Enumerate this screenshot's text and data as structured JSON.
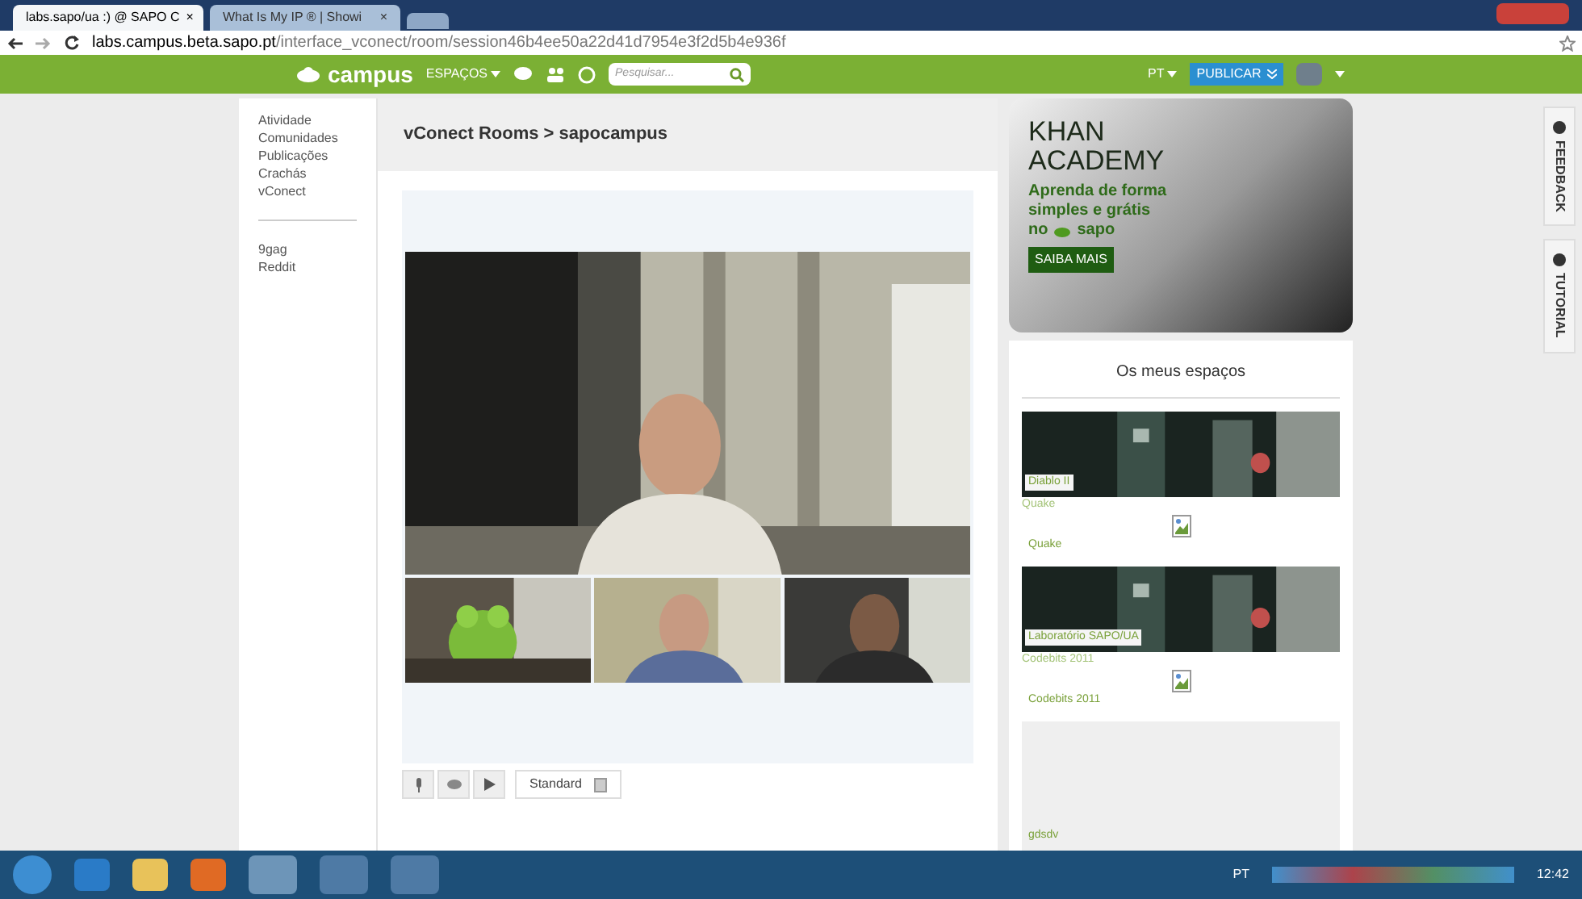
{
  "browser": {
    "tabs": [
      {
        "label": "labs.sapo/ua :) @ SAPO C",
        "selected": true,
        "close": "×"
      },
      {
        "label": "What Is My IP ® | Showi",
        "selected": false,
        "close": "×"
      }
    ],
    "url_host": "labs.campus.beta.sapo.pt",
    "url_path": "/interface_vconect/room/session46b4ee50a22d41d7954e3f2d5b4e936f"
  },
  "navbar": {
    "logo": "campus",
    "menu": "ESPAÇOS",
    "search": {
      "placeholder": "Pesquisar..."
    },
    "language": "PT",
    "publish": "PUBLICAR"
  },
  "sidebar": {
    "items": [
      {
        "label": "Atividade"
      },
      {
        "label": "Comunidades"
      },
      {
        "label": "Publicações"
      },
      {
        "label": "Crachás"
      },
      {
        "label": "vConect"
      }
    ],
    "links": [
      {
        "label": "9gag"
      },
      {
        "label": "Reddit"
      }
    ]
  },
  "room": {
    "title": "vConect Rooms > sapocampus",
    "quality": "Standard"
  },
  "ad": {
    "title_1": "KHAN",
    "title_2": "ACADEMY",
    "line_1": "Aprenda de forma",
    "line_2": "simples e grátis",
    "line_3_prefix": "no",
    "line_3_brand": "sapo",
    "button": "SAIBA MAIS"
  },
  "spaces": {
    "title": "Os meus espaços",
    "items": [
      {
        "banner_label": "Diablo II",
        "name": "Quake",
        "caption": "Quake"
      },
      {
        "banner_label": "Laboratório SAPO/UA",
        "name": "Codebits 2011",
        "caption": "Codebits 2011"
      }
    ],
    "last": "gdsdv"
  },
  "side_tabs": [
    {
      "label": "FEEDBACK"
    },
    {
      "label": "TUTORIAL"
    }
  ],
  "taskbar": {
    "language": "PT",
    "time": "12:42"
  }
}
